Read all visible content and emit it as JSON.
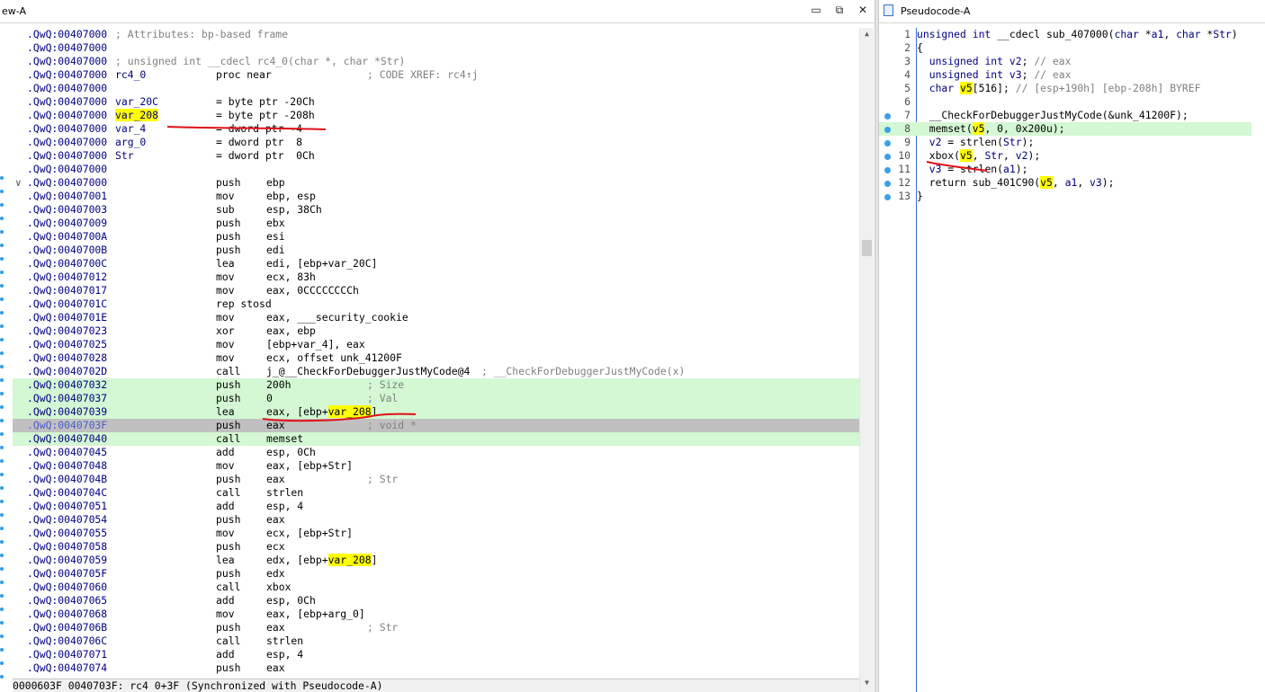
{
  "disasm_window": {
    "title": "ew-A",
    "buttons": {
      "restore": "▭",
      "float": "⧉",
      "close": "✕"
    },
    "status": "0000603F 0040703F: rc4 0+3F (Synchronized with Pseudocode-A)",
    "lines": [
      {
        "addr": ".QwQ:00407000",
        "comment": "; Attributes: bp-based frame"
      },
      {
        "addr": ".QwQ:00407000"
      },
      {
        "addr": ".QwQ:00407000",
        "comment": "; unsigned int __cdecl rc4_0(char *, char *Str)"
      },
      {
        "addr": ".QwQ:00407000",
        "c2": "rc4_0",
        "c3": "proc near",
        "comment2": "; CODE XREF: rc4↑j"
      },
      {
        "addr": ".QwQ:00407000"
      },
      {
        "addr": ".QwQ:00407000",
        "c2": "var_20C",
        "c3": "= byte ptr -20Ch"
      },
      {
        "addr": ".QwQ:00407000",
        "c2": "var_208",
        "c2_hl": true,
        "c3": "= byte ptr -208h"
      },
      {
        "addr": ".QwQ:00407000",
        "c2": "var_4",
        "c3": "= dword ptr -4"
      },
      {
        "addr": ".QwQ:00407000",
        "c2": "arg_0",
        "c3": "= dword ptr  8"
      },
      {
        "addr": ".QwQ:00407000",
        "c2": "Str",
        "c3": "= dword ptr  0Ch"
      },
      {
        "addr": ".QwQ:00407000"
      },
      {
        "addr": ".QwQ:00407000",
        "c3": "push",
        "c4": "ebp",
        "chev": "∨"
      },
      {
        "addr": ".QwQ:00407001",
        "c3": "mov",
        "c4": "ebp, esp"
      },
      {
        "addr": ".QwQ:00407003",
        "c3": "sub",
        "c4": "esp, 38Ch"
      },
      {
        "addr": ".QwQ:00407009",
        "c3": "push",
        "c4": "ebx"
      },
      {
        "addr": ".QwQ:0040700A",
        "c3": "push",
        "c4": "esi"
      },
      {
        "addr": ".QwQ:0040700B",
        "c3": "push",
        "c4": "edi"
      },
      {
        "addr": ".QwQ:0040700C",
        "c3": "lea",
        "c4": "edi, [ebp+var_20C]"
      },
      {
        "addr": ".QwQ:00407012",
        "c3": "mov",
        "c4": "ecx, 83h"
      },
      {
        "addr": ".QwQ:00407017",
        "c3": "mov",
        "c4": "eax, 0CCCCCCCCh"
      },
      {
        "addr": ".QwQ:0040701C",
        "c3": "rep stosd"
      },
      {
        "addr": ".QwQ:0040701E",
        "c3": "mov",
        "c4": "eax, ___security_cookie"
      },
      {
        "addr": ".QwQ:00407023",
        "c3": "xor",
        "c4": "eax, ebp"
      },
      {
        "addr": ".QwQ:00407025",
        "c3": "mov",
        "c4": "[ebp+var_4], eax"
      },
      {
        "addr": ".QwQ:00407028",
        "c3": "mov",
        "c4": "ecx, offset unk_41200F"
      },
      {
        "addr": ".QwQ:0040702D",
        "c3": "call",
        "c4": "j_@__CheckForDebuggerJustMyCode@4",
        "comment4": "; __CheckForDebuggerJustMyCode(x)"
      },
      {
        "addr": ".QwQ:00407032",
        "c3": "push",
        "c4": "200h",
        "comment3": "; Size",
        "hl": true
      },
      {
        "addr": ".QwQ:00407037",
        "c3": "push",
        "c4": "0",
        "comment3": "; Val",
        "hl": true
      },
      {
        "addr": ".QwQ:00407039",
        "c3": "lea",
        "c4_pre": "eax, [ebp+",
        "c4_hl": "var_208",
        "c4_post": "]",
        "hl": true
      },
      {
        "addr": ".QwQ:0040703F",
        "c3": "push",
        "c4": "eax",
        "comment3": "; void *",
        "cur": true
      },
      {
        "addr": ".QwQ:00407040",
        "c3": "call",
        "c4": "memset",
        "hl": true
      },
      {
        "addr": ".QwQ:00407045",
        "c3": "add",
        "c4": "esp, 0Ch"
      },
      {
        "addr": ".QwQ:00407048",
        "c3": "mov",
        "c4": "eax, [ebp+Str]"
      },
      {
        "addr": ".QwQ:0040704B",
        "c3": "push",
        "c4": "eax",
        "comment3": "; Str"
      },
      {
        "addr": ".QwQ:0040704C",
        "c3": "call",
        "c4": "strlen"
      },
      {
        "addr": ".QwQ:00407051",
        "c3": "add",
        "c4": "esp, 4"
      },
      {
        "addr": ".QwQ:00407054",
        "c3": "push",
        "c4": "eax"
      },
      {
        "addr": ".QwQ:00407055",
        "c3": "mov",
        "c4": "ecx, [ebp+Str]"
      },
      {
        "addr": ".QwQ:00407058",
        "c3": "push",
        "c4": "ecx"
      },
      {
        "addr": ".QwQ:00407059",
        "c3": "lea",
        "c4_pre": "edx, [ebp+",
        "c4_hl": "var_208",
        "c4_post": "]"
      },
      {
        "addr": ".QwQ:0040705F",
        "c3": "push",
        "c4": "edx"
      },
      {
        "addr": ".QwQ:00407060",
        "c3": "call",
        "c4": "xbox"
      },
      {
        "addr": ".QwQ:00407065",
        "c3": "add",
        "c4": "esp, 0Ch"
      },
      {
        "addr": ".QwQ:00407068",
        "c3": "mov",
        "c4": "eax, [ebp+arg_0]"
      },
      {
        "addr": ".QwQ:0040706B",
        "c3": "push",
        "c4": "eax",
        "comment3": "; Str"
      },
      {
        "addr": ".QwQ:0040706C",
        "c3": "call",
        "c4": "strlen"
      },
      {
        "addr": ".QwQ:00407071",
        "c3": "add",
        "c4": "esp, 4"
      },
      {
        "addr": ".QwQ:00407074",
        "c3": "push",
        "c4": "eax"
      }
    ]
  },
  "pseudocode_window": {
    "title": "Pseudocode-A",
    "lines": [
      {
        "n": "1",
        "segs": [
          [
            "kw",
            "unsigned int "
          ],
          [
            "",
            "__cdecl sub_407000("
          ],
          [
            "kw",
            "char "
          ],
          [
            "",
            "*"
          ],
          [
            "var",
            "a1"
          ],
          [
            "",
            ", "
          ],
          [
            "kw",
            "char "
          ],
          [
            "",
            "*"
          ],
          [
            "var",
            "Str"
          ],
          [
            "",
            ")"
          ]
        ]
      },
      {
        "n": "2",
        "segs": [
          [
            "",
            "{"
          ]
        ]
      },
      {
        "n": "3",
        "segs": [
          [
            "",
            "  "
          ],
          [
            "kw",
            "unsigned int "
          ],
          [
            "var",
            "v2"
          ],
          [
            "",
            "; "
          ],
          [
            "cm",
            "// eax"
          ]
        ]
      },
      {
        "n": "4",
        "segs": [
          [
            "",
            "  "
          ],
          [
            "kw",
            "unsigned int "
          ],
          [
            "var",
            "v3"
          ],
          [
            "",
            "; "
          ],
          [
            "cm",
            "// eax"
          ]
        ]
      },
      {
        "n": "5",
        "segs": [
          [
            "",
            "  "
          ],
          [
            "kw",
            "char "
          ],
          [
            "hl",
            "v5"
          ],
          [
            "",
            "[516]; "
          ],
          [
            "cm",
            "// [esp+190h] [ebp-208h] BYREF"
          ]
        ]
      },
      {
        "n": "6",
        "segs": []
      },
      {
        "n": "7",
        "bp": true,
        "segs": [
          [
            "",
            "  __CheckForDebuggerJustMyCode(&unk_41200F);"
          ]
        ]
      },
      {
        "n": "8",
        "bp": true,
        "hl": true,
        "segs": [
          [
            "",
            "  memset("
          ],
          [
            "hl",
            "v5"
          ],
          [
            "",
            ", 0, 0x200u);"
          ]
        ]
      },
      {
        "n": "9",
        "bp": true,
        "segs": [
          [
            "",
            "  "
          ],
          [
            "var",
            "v2"
          ],
          [
            "",
            " = strlen("
          ],
          [
            "var",
            "Str"
          ],
          [
            "",
            ");"
          ]
        ]
      },
      {
        "n": "10",
        "bp": true,
        "segs": [
          [
            "",
            "  xbox("
          ],
          [
            "hl",
            "v5"
          ],
          [
            "",
            ", "
          ],
          [
            "var",
            "Str"
          ],
          [
            "",
            ", "
          ],
          [
            "var",
            "v2"
          ],
          [
            "",
            ");"
          ]
        ]
      },
      {
        "n": "11",
        "bp": true,
        "segs": [
          [
            "",
            "  "
          ],
          [
            "var",
            "v3"
          ],
          [
            "",
            " = strlen("
          ],
          [
            "var",
            "a1"
          ],
          [
            "",
            ");"
          ]
        ]
      },
      {
        "n": "12",
        "bp": true,
        "segs": [
          [
            "",
            "  return sub_401C90("
          ],
          [
            "hl",
            "v5"
          ],
          [
            "",
            ", "
          ],
          [
            "var",
            "a1"
          ],
          [
            "",
            ", "
          ],
          [
            "var",
            "v3"
          ],
          [
            "",
            ");"
          ]
        ]
      },
      {
        "n": "13",
        "bp": true,
        "segs": [
          [
            "",
            "}"
          ]
        ]
      }
    ]
  }
}
